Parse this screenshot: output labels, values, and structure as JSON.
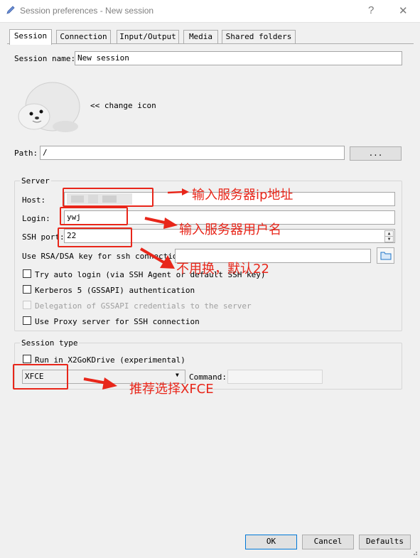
{
  "window": {
    "title": "Session preferences - New session",
    "help_glyph": "?",
    "close_glyph": "✕"
  },
  "tabs": [
    {
      "label": "Session",
      "active": true
    },
    {
      "label": "Connection"
    },
    {
      "label": "Input/Output"
    },
    {
      "label": "Media"
    },
    {
      "label": "Shared folders"
    }
  ],
  "session": {
    "name_label": "Session name:",
    "name_value": "New session",
    "change_icon_label": "<< change icon",
    "path_label": "Path:",
    "path_value": "/",
    "path_browse_label": "..."
  },
  "server": {
    "group_title": "Server",
    "host_label": "Host:",
    "host_value": "",
    "login_label": "Login:",
    "login_value": "ywj",
    "ssh_port_label": "SSH port:",
    "ssh_port_value": "22",
    "key_label": "Use RSA/DSA key for ssh connection:",
    "key_value": "",
    "checkboxes": [
      {
        "label": "Try auto login (via SSH Agent or default SSH key)",
        "checked": false,
        "enabled": true
      },
      {
        "label": "Kerberos 5 (GSSAPI) authentication",
        "checked": false,
        "enabled": true
      },
      {
        "label": "Delegation of GSSAPI credentials to the server",
        "checked": false,
        "enabled": false
      },
      {
        "label": "Use Proxy server for SSH connection",
        "checked": false,
        "enabled": true
      }
    ]
  },
  "session_type": {
    "group_title": "Session type",
    "run_x2go_label": "Run in X2GoKDrive (experimental)",
    "type_value": "XFCE",
    "command_label": "Command:",
    "command_value": ""
  },
  "annotations": {
    "host_note": "输入服务器ip地址",
    "login_note": "输入服务器用户名",
    "port_note": "不用换，默认22",
    "type_note": "推荐选择XFCE"
  },
  "buttons": {
    "ok": "OK",
    "cancel": "Cancel",
    "defaults": "Defaults"
  },
  "colors": {
    "annotation_red": "#e8261a",
    "default_button_border": "#0078d7",
    "folder_icon_blue": "#1e74c8"
  }
}
